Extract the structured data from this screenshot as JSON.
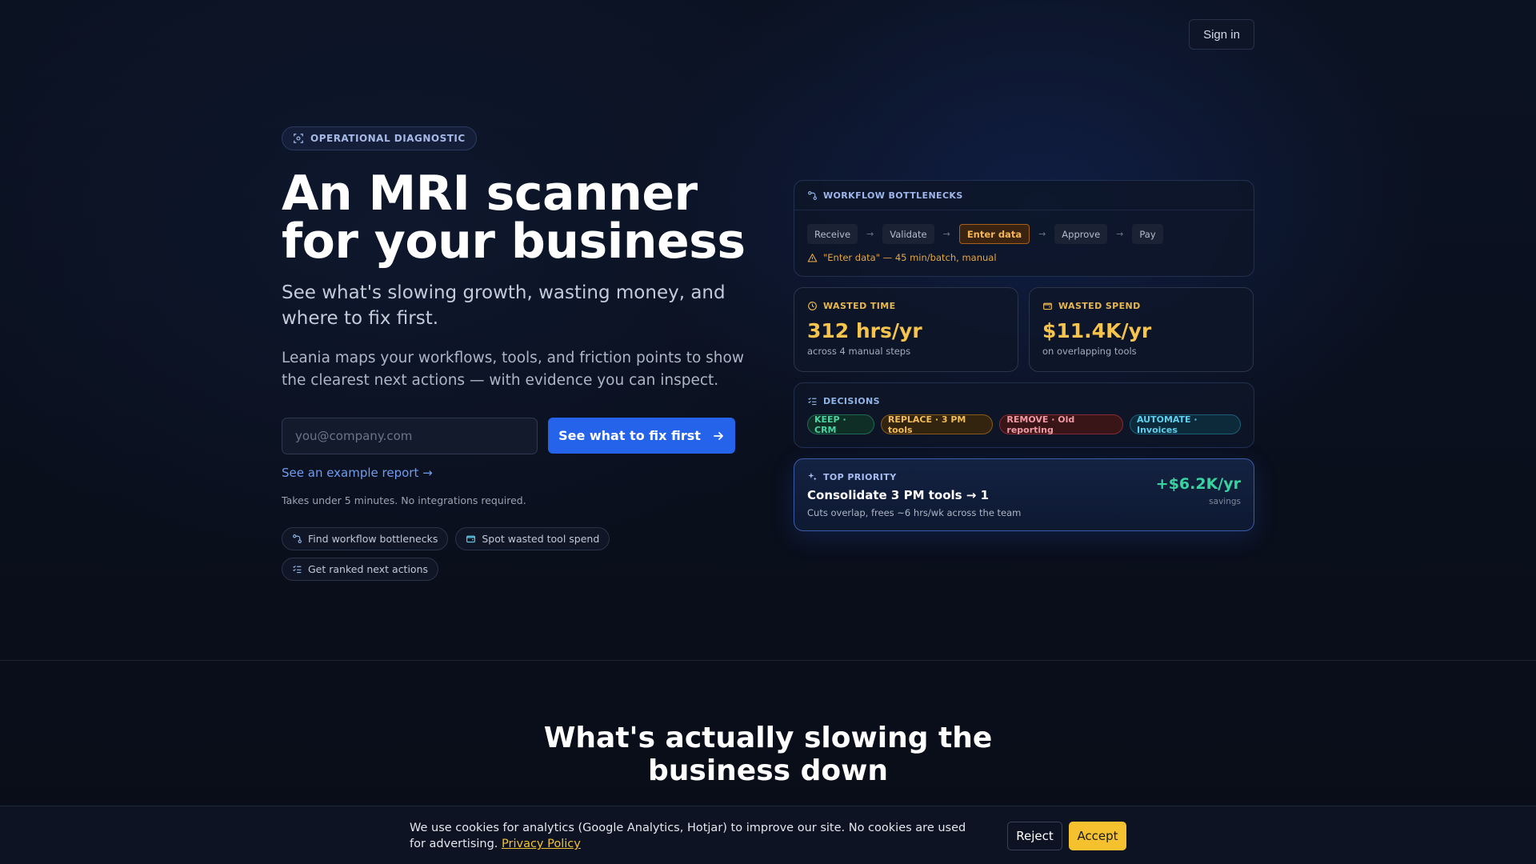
{
  "header": {
    "signin_label": "Sign in"
  },
  "hero": {
    "badge": "OPERATIONAL DIAGNOSTIC",
    "title_line1": "An MRI scanner",
    "title_line2": "for your business",
    "subtitle": "See what's slowing growth, wasting money, and where to fix first.",
    "description": "Leania maps your workflows, tools, and friction points to show the clearest next actions — with evidence you can inspect.",
    "email_placeholder": "you@company.com",
    "cta_label": "See what to fix first",
    "example_link": "See an example report →",
    "note": "Takes under 5 minutes. No integrations required.",
    "features": [
      "Find workflow bottlenecks",
      "Spot wasted tool spend",
      "Get ranked next actions"
    ]
  },
  "workflow": {
    "label": "WORKFLOW BOTTLENECKS",
    "steps": [
      "Receive",
      "Validate",
      "Enter data",
      "Approve",
      "Pay"
    ],
    "arrow": "→",
    "warning": "\"Enter data\" — 45 min/batch, manual"
  },
  "wasted_time": {
    "label": "WASTED TIME",
    "value": "312 hrs/yr",
    "sub": "across 4 manual steps"
  },
  "wasted_spend": {
    "label": "WASTED SPEND",
    "value": "$11.4K/yr",
    "sub": "on overlapping tools"
  },
  "decisions": {
    "label": "DECISIONS",
    "tags": [
      "KEEP · CRM",
      "REPLACE · 3 PM tools",
      "REMOVE · Old reporting",
      "AUTOMATE · Invoices"
    ]
  },
  "top_priority": {
    "label": "TOP PRIORITY",
    "title": "Consolidate 3 PM tools → 1",
    "sub": "Cuts overlap, frees ~6 hrs/wk across the team",
    "value": "+$6.2K/yr",
    "unit": "savings"
  },
  "section": {
    "title": "What's actually slowing the business down"
  },
  "cookie": {
    "text": "We use cookies for analytics (Google Analytics, Hotjar) to improve our site. No cookies are used for advertising.",
    "link": "Privacy Policy",
    "reject": "Reject",
    "accept": "Accept"
  },
  "colors": {
    "accent": "#2563eb",
    "warning": "#f5b552",
    "spend": "#f6c44c",
    "savings": "#38d39f",
    "cookie_accept": "#f5c12e"
  }
}
